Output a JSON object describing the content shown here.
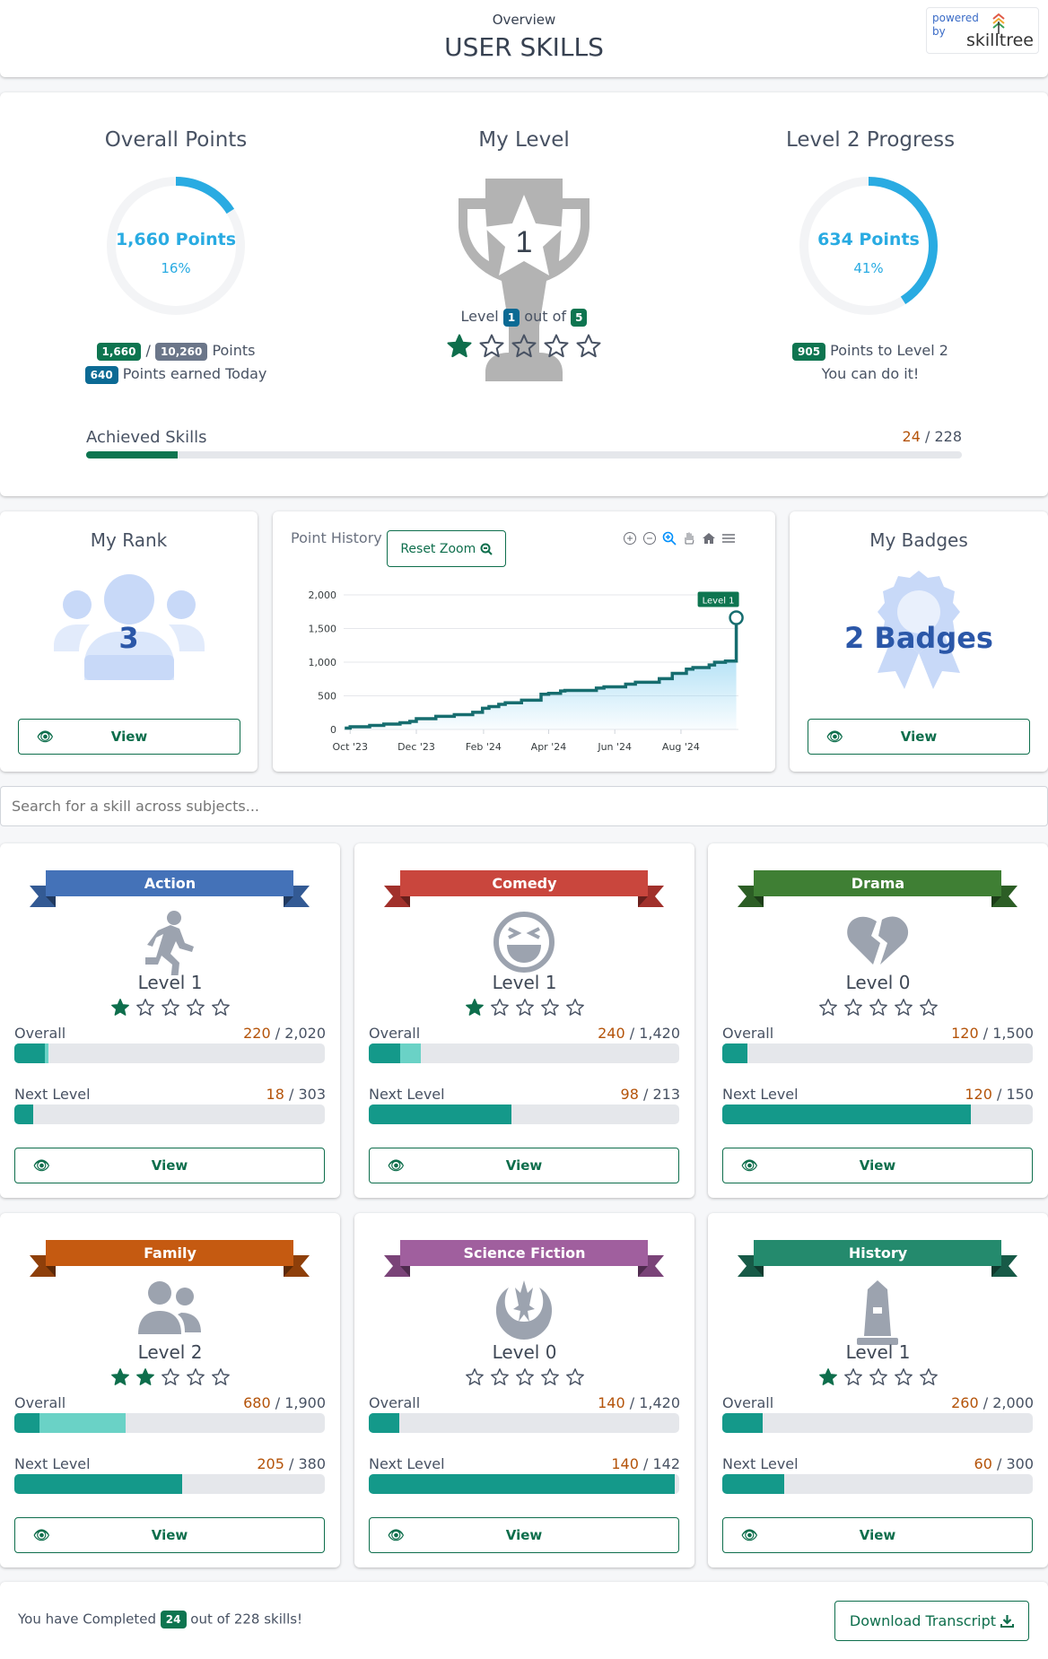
{
  "header": {
    "subtitle": "Overview",
    "title": "USER SKILLS",
    "powered_by": "powered by",
    "brand": "skilltree"
  },
  "summary": {
    "overall": {
      "title": "Overall Points",
      "points_label": "1,660 Points",
      "percent_label": "16%",
      "progress": 0.16,
      "earned": "1,660",
      "total": "10,260",
      "points_word": "Points",
      "today": "640",
      "today_label": "Points earned Today"
    },
    "level": {
      "title": "My Level",
      "trophy_number": "1",
      "level_word": "Level",
      "level": "1",
      "out_of": "out of",
      "max": "5",
      "stars_filled": 1,
      "stars_total": 5
    },
    "next": {
      "title": "Level 2 Progress",
      "points_label": "634 Points",
      "percent_label": "41%",
      "progress": 0.41,
      "remaining": "905",
      "remaining_label": "Points to Level 2",
      "encouragement": "You can do it!"
    },
    "achieved": {
      "label": "Achieved Skills",
      "done": "24",
      "total": "/ 228",
      "progress": 0.105
    }
  },
  "rank": {
    "title": "My Rank",
    "value": "3",
    "button": "View"
  },
  "badges": {
    "title": "My Badges",
    "value": "2 Badges",
    "button": "View"
  },
  "history": {
    "title": "Point History",
    "reset_zoom": "Reset Zoom",
    "toolbar_icons": [
      "zoom-in-icon",
      "zoom-out-icon",
      "selection-zoom-icon",
      "pan-icon",
      "home-icon",
      "menu-icon"
    ]
  },
  "chart_data": {
    "type": "area",
    "step": true,
    "title": "Point History",
    "ylim": [
      0,
      2000
    ],
    "yticks": [
      "0",
      "500",
      "1,000",
      "1,500",
      "2,000"
    ],
    "yticks_values": [
      0,
      500,
      1000,
      1500,
      2000
    ],
    "xticks": [
      "Oct '23",
      "Dec '23",
      "Feb '24",
      "Apr '24",
      "Jun '24",
      "Aug '24"
    ],
    "xticks_dates": [
      "2023-10-01",
      "2023-12-01",
      "2024-02-01",
      "2024-04-01",
      "2024-06-01",
      "2024-08-01"
    ],
    "xlim": [
      "2023-09-25",
      "2024-09-23"
    ],
    "annotation": {
      "label": "Level 1",
      "date": "2024-09-21",
      "value": 1660
    },
    "line_color": "#166d6f",
    "fill_color": "#8fd3f2",
    "grid": true,
    "points": [
      [
        "2023-09-26",
        20
      ],
      [
        "2023-10-01",
        40
      ],
      [
        "2023-10-19",
        60
      ],
      [
        "2023-11-01",
        80
      ],
      [
        "2023-11-16",
        100
      ],
      [
        "2023-11-25",
        120
      ],
      [
        "2023-12-01",
        160
      ],
      [
        "2023-12-19",
        195
      ],
      [
        "2024-01-05",
        220
      ],
      [
        "2024-01-22",
        255
      ],
      [
        "2024-01-31",
        315
      ],
      [
        "2024-02-06",
        340
      ],
      [
        "2024-02-15",
        373
      ],
      [
        "2024-02-21",
        397
      ],
      [
        "2024-03-07",
        435
      ],
      [
        "2024-03-25",
        523
      ],
      [
        "2024-04-01",
        537
      ],
      [
        "2024-04-12",
        571
      ],
      [
        "2024-04-16",
        580
      ],
      [
        "2024-05-15",
        615
      ],
      [
        "2024-05-22",
        634
      ],
      [
        "2024-06-11",
        673
      ],
      [
        "2024-06-20",
        702
      ],
      [
        "2024-07-12",
        755
      ],
      [
        "2024-07-24",
        833
      ],
      [
        "2024-08-06",
        896
      ],
      [
        "2024-08-12",
        920
      ],
      [
        "2024-08-27",
        959
      ],
      [
        "2024-09-01",
        998
      ],
      [
        "2024-09-11",
        1017
      ],
      [
        "2024-09-21",
        1017
      ],
      [
        "2024-09-21",
        1660
      ]
    ]
  },
  "search": {
    "placeholder": "Search for a skill across subjects..."
  },
  "subjects": [
    {
      "name": "Action",
      "icon": "running-icon",
      "color": "#4472b8",
      "dark": "#335a94",
      "level": "Level 1",
      "stars": 1,
      "overall_earned": "220",
      "overall_total": "/ 2,020",
      "overall_progress": 0.109,
      "overall_prior": 0.098,
      "next_earned": "18",
      "next_total": "/ 303",
      "next_progress": 0.06
    },
    {
      "name": "Comedy",
      "icon": "laugh-icon",
      "color": "#c9463d",
      "dark": "#a1302b",
      "level": "Level 1",
      "stars": 1,
      "overall_earned": "240",
      "overall_total": "/ 1,420",
      "overall_progress": 0.169,
      "overall_prior": 0.1,
      "next_earned": "98",
      "next_total": "/ 213",
      "next_progress": 0.46
    },
    {
      "name": "Drama",
      "icon": "heart-broken-icon",
      "color": "#3f7f34",
      "dark": "#2c5e25",
      "level": "Level 0",
      "stars": 0,
      "overall_earned": "120",
      "overall_total": "/ 1,500",
      "overall_progress": 0.08,
      "overall_prior": 0.08,
      "next_earned": "120",
      "next_total": "/ 150",
      "next_progress": 0.8
    },
    {
      "name": "Family",
      "icon": "users-icon",
      "color": "#c55a11",
      "dark": "#8e3f0a",
      "level": "Level 2",
      "stars": 2,
      "overall_earned": "680",
      "overall_total": "/ 1,900",
      "overall_progress": 0.358,
      "overall_prior": 0.08,
      "next_earned": "205",
      "next_total": "/ 380",
      "next_progress": 0.54
    },
    {
      "name": "Science Fiction",
      "icon": "jedi-order-icon",
      "color": "#a05f9e",
      "dark": "#7a4378",
      "level": "Level 0",
      "stars": 0,
      "overall_earned": "140",
      "overall_total": "/ 1,420",
      "overall_progress": 0.099,
      "overall_prior": 0.099,
      "next_earned": "140",
      "next_total": "/ 142",
      "next_progress": 0.986
    },
    {
      "name": "History",
      "icon": "monument-icon",
      "color": "#248a6d",
      "dark": "#175a47",
      "level": "Level 1",
      "stars": 1,
      "overall_earned": "260",
      "overall_total": "/ 2,000",
      "overall_progress": 0.13,
      "overall_prior": 0.13,
      "next_earned": "60",
      "next_total": "/ 300",
      "next_progress": 0.2
    }
  ],
  "labels": {
    "overall": "Overall",
    "next_level": "Next Level",
    "view": "View"
  },
  "footer": {
    "prefix": "You have Completed",
    "count": "24",
    "suffix": "out of 228 skills!",
    "download": "Download Transcript"
  },
  "colors": {
    "green": "#0e6e4c",
    "teal": "#14998a",
    "teal_light": "#6ad2c6",
    "orange": "#b45309",
    "blue": "#29abe2",
    "badge_blue": "#0b6a94",
    "badge_gray": "#6b7689"
  }
}
